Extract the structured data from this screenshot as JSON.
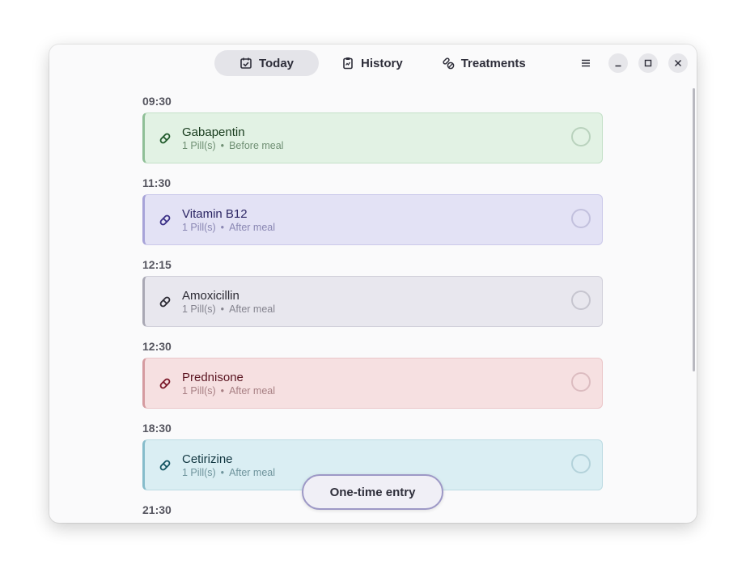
{
  "header": {
    "tabs": [
      {
        "label": "Today",
        "icon": "calendar-check-icon",
        "active": true
      },
      {
        "label": "History",
        "icon": "clipboard-icon",
        "active": false
      },
      {
        "label": "Treatments",
        "icon": "pills-icon",
        "active": false
      }
    ],
    "window_controls": [
      "menu-icon",
      "minimize-icon",
      "maximize-icon",
      "close-icon"
    ]
  },
  "schedule": [
    {
      "time": "09:30",
      "name": "Gabapentin",
      "dose": "1 Pill(s)",
      "note": "Before meal",
      "colors": {
        "bg": "#e2f2e4",
        "border": "#c4e0c8",
        "accent": "#8fbf97",
        "name": "#173a1c",
        "meta": "#6f8f73",
        "icon": "#1f5a2a",
        "check": "#b9d2bd"
      }
    },
    {
      "time": "11:30",
      "name": "Vitamin B12",
      "dose": "1 Pill(s)",
      "note": "After meal",
      "colors": {
        "bg": "#e3e2f5",
        "border": "#cbc9ea",
        "accent": "#a7a3d8",
        "name": "#2b2563",
        "meta": "#8a87b3",
        "icon": "#3a2f86",
        "check": "#c2c0dd"
      }
    },
    {
      "time": "12:15",
      "name": "Amoxicillin",
      "dose": "1 Pill(s)",
      "note": "After meal",
      "colors": {
        "bg": "#e8e7ee",
        "border": "#d1d0da",
        "accent": "#a9a8b4",
        "name": "#2b2a33",
        "meta": "#85848f",
        "icon": "#2b2a33",
        "check": "#c6c5cf"
      }
    },
    {
      "time": "12:30",
      "name": "Prednisone",
      "dose": "1 Pill(s)",
      "note": "After meal",
      "colors": {
        "bg": "#f6e0e1",
        "border": "#ebc6c9",
        "accent": "#d59ba0",
        "name": "#5a1420",
        "meta": "#a77f83",
        "icon": "#7a1728",
        "check": "#dcbcc0"
      }
    },
    {
      "time": "18:30",
      "name": "Cetirizine",
      "dose": "1 Pill(s)",
      "note": "After meal",
      "colors": {
        "bg": "#daeef3",
        "border": "#bcdbe3",
        "accent": "#86bccb",
        "name": "#113640",
        "meta": "#6f949c",
        "icon": "#135562",
        "check": "#b3d2da"
      }
    },
    {
      "time": "21:30"
    }
  ],
  "fab": {
    "label": "One-time entry"
  }
}
